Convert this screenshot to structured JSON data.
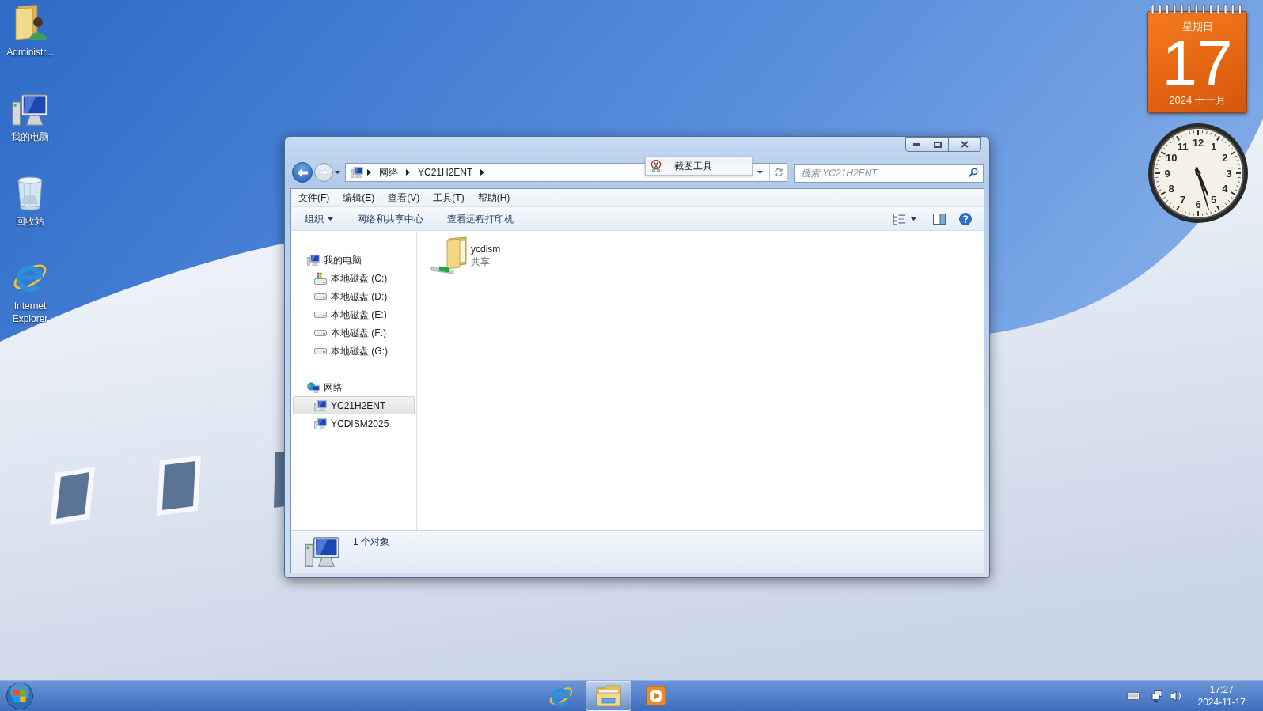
{
  "desktop_icons": [
    {
      "label": "Administr...",
      "kind": "user-folder"
    },
    {
      "label": "我的电脑",
      "kind": "computer"
    },
    {
      "label": "回收站",
      "kind": "recycle-bin"
    },
    {
      "label": "Internet Explorer",
      "kind": "browser"
    }
  ],
  "calendar_gadget": {
    "weekday": "星期日",
    "day": "17",
    "month_year": "2024 十一月"
  },
  "clock_gadget": {
    "numerals": [
      "11",
      "12",
      "1",
      "10",
      "2",
      "9",
      "3",
      "8",
      "4",
      "7",
      "5",
      "6"
    ]
  },
  "window": {
    "address_path": [
      "网络",
      "YC21H2ENT"
    ],
    "search": {
      "placeholder": "搜索 YC21H2ENT"
    },
    "menu": [
      "文件(F)",
      "编辑(E)",
      "查看(V)",
      "工具(T)",
      "帮助(H)"
    ],
    "toolbar": [
      {
        "label": "组织",
        "dropdown": true
      },
      {
        "label": "网络和共享中心",
        "dropdown": false
      },
      {
        "label": "查看远程打印机",
        "dropdown": false
      }
    ],
    "nav_pane": [
      {
        "label": "我的电脑",
        "kind": "computer",
        "selected": false,
        "children": [
          {
            "label": "本地磁盘 (C:)",
            "kind": "system-drive",
            "selected": false
          },
          {
            "label": "本地磁盘 (D:)",
            "kind": "drive",
            "selected": false
          },
          {
            "label": "本地磁盘 (E:)",
            "kind": "drive",
            "selected": false
          },
          {
            "label": "本地磁盘 (F:)",
            "kind": "drive",
            "selected": false
          },
          {
            "label": "本地磁盘 (G:)",
            "kind": "drive",
            "selected": false
          }
        ]
      },
      {
        "label": "网络",
        "kind": "network",
        "selected": false,
        "children": [
          {
            "label": "YC21H2ENT",
            "kind": "computer",
            "selected": true
          },
          {
            "label": "YCDISM2025",
            "kind": "computer",
            "selected": false
          }
        ]
      }
    ],
    "items": [
      {
        "name": "ycdism",
        "subtitle": "共享",
        "kind": "shared-folder"
      }
    ],
    "status_bar": {
      "text": "1 个对象"
    }
  },
  "snipping_tool_tag": {
    "label": "截图工具"
  },
  "taskbar": {
    "pinned": [
      {
        "kind": "browser",
        "selected": false
      },
      {
        "kind": "file-explorer",
        "selected": true
      },
      {
        "kind": "media-player",
        "selected": false
      }
    ],
    "tray": {
      "time": "17:27",
      "date": "2024-11-17"
    }
  }
}
